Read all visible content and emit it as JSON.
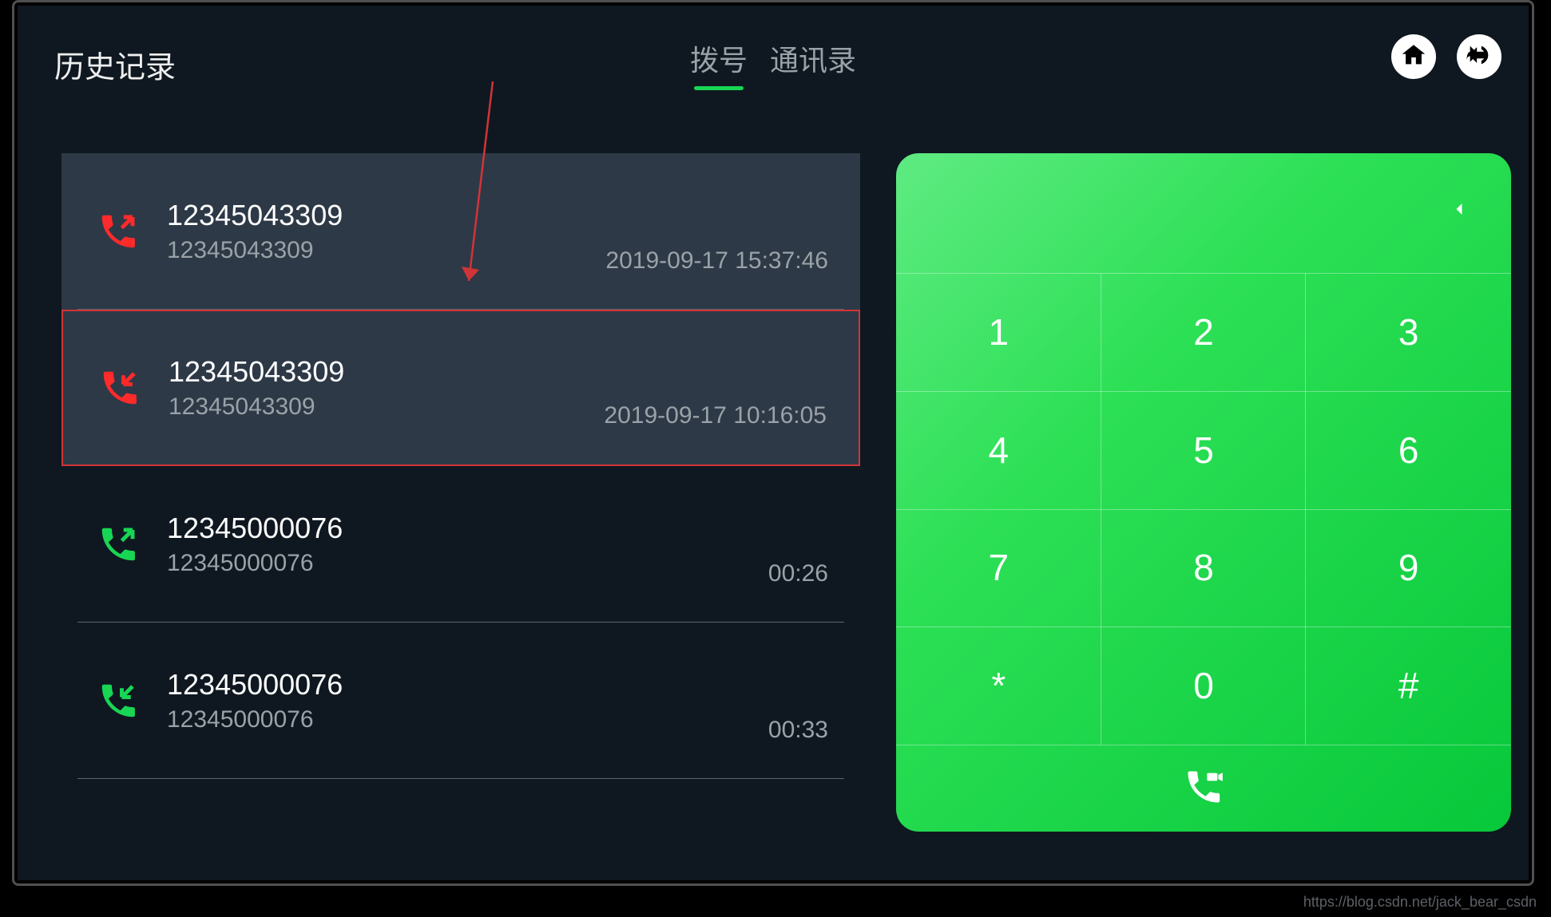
{
  "header": {
    "title": "历史记录",
    "tabs": [
      {
        "label": "拨号",
        "active": true
      },
      {
        "label": "通讯录",
        "active": false
      }
    ]
  },
  "history": [
    {
      "number": "12345043309",
      "subnumber": "12345043309",
      "time": "2019-09-17 15:37:46",
      "direction": "outgoing-missed",
      "iconColor": "#ff2a2a",
      "highlighted": false,
      "transparent": false
    },
    {
      "number": "12345043309",
      "subnumber": "12345043309",
      "time": "2019-09-17 10:16:05",
      "direction": "incoming-missed",
      "iconColor": "#ff2a2a",
      "highlighted": true,
      "transparent": false
    },
    {
      "number": "12345000076",
      "subnumber": "12345000076",
      "time": "00:26",
      "direction": "outgoing",
      "iconColor": "#18d654",
      "highlighted": false,
      "transparent": true
    },
    {
      "number": "12345000076",
      "subnumber": "12345000076",
      "time": "00:33",
      "direction": "incoming",
      "iconColor": "#18d654",
      "highlighted": false,
      "transparent": true
    }
  ],
  "dialpad": {
    "keys": [
      "1",
      "2",
      "3",
      "4",
      "5",
      "6",
      "7",
      "8",
      "9",
      "*",
      "0",
      "#"
    ]
  },
  "watermark": "https://blog.csdn.net/jack_bear_csdn"
}
